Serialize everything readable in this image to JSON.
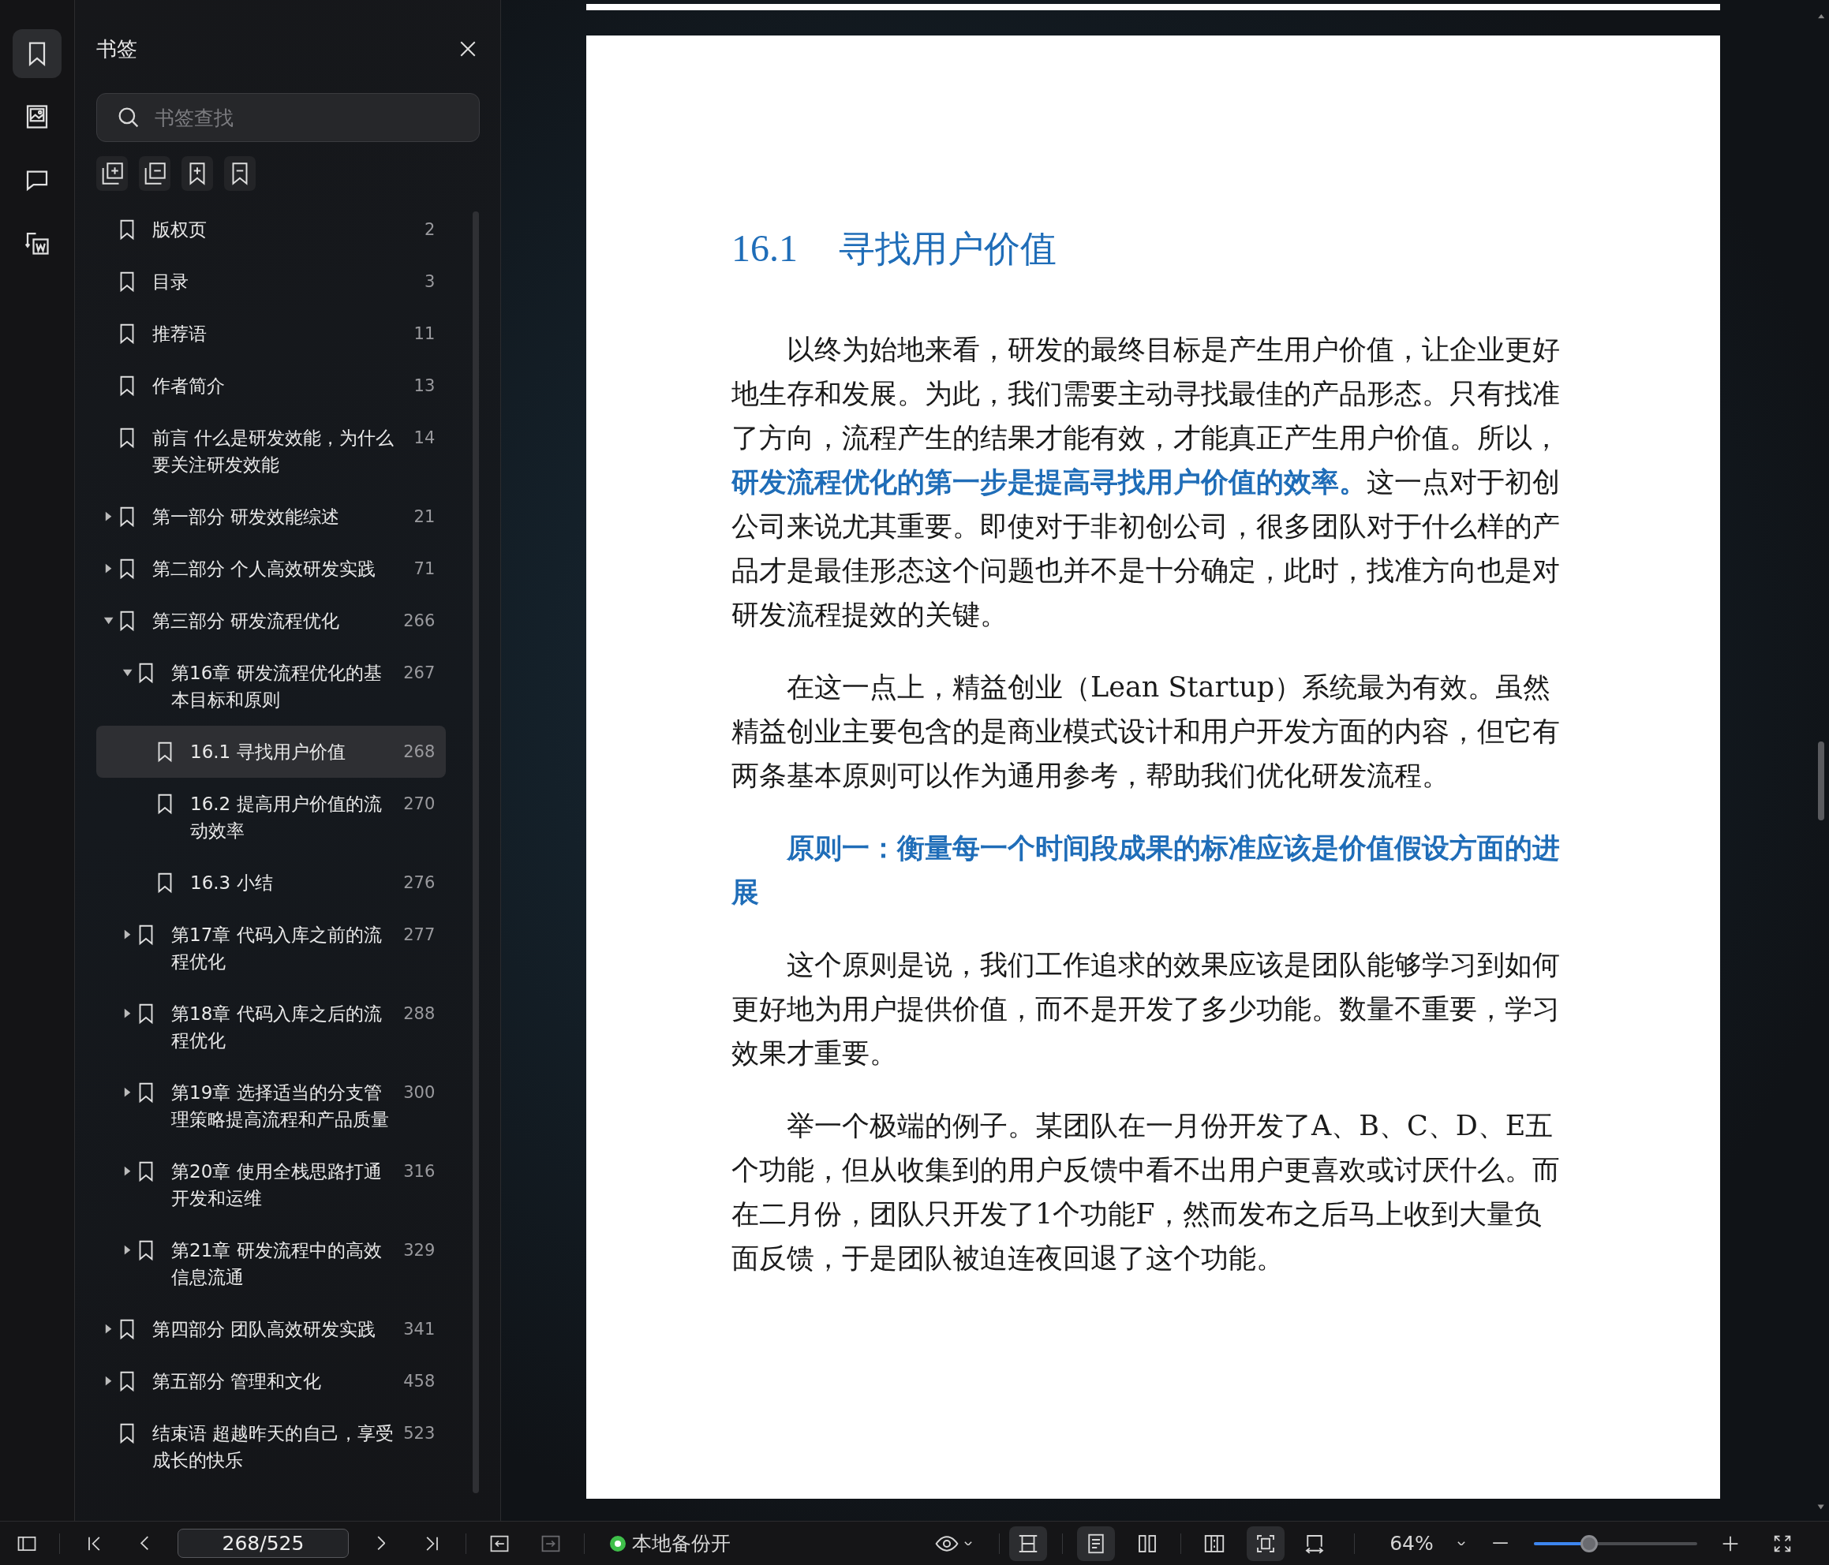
{
  "rail": [
    {
      "kind": "bookmarks",
      "selected": true
    },
    {
      "kind": "images",
      "selected": false
    },
    {
      "kind": "comments",
      "selected": false
    },
    {
      "kind": "convert",
      "selected": false
    }
  ],
  "sidebar": {
    "title": "书签",
    "search": {
      "placeholder": "书签查找"
    },
    "bookmarks": [
      {
        "title": "版权页",
        "page": "2",
        "kind": "leaf",
        "selected": false
      },
      {
        "title": "目录",
        "page": "3",
        "kind": "leaf",
        "selected": false
      },
      {
        "title": "推荐语",
        "page": "11",
        "kind": "leaf",
        "selected": false
      },
      {
        "title": "作者简介",
        "page": "13",
        "kind": "leaf",
        "selected": false
      },
      {
        "title": "前言 什么是研发效能，为什么要关注研发效能",
        "page": "14",
        "kind": "leaf",
        "selected": false
      },
      {
        "title": "第一部分 研发效能综述",
        "page": "21",
        "kind": "branch",
        "expanded": false,
        "selected": false
      },
      {
        "title": "第二部分 个人高效研发实践",
        "page": "71",
        "kind": "branch",
        "expanded": false,
        "selected": false
      },
      {
        "title": "第三部分 研发流程优化",
        "page": "266",
        "kind": "branch",
        "expanded": true,
        "selected": false,
        "children": [
          {
            "title": "第16章 研发流程优化的基本目标和原则",
            "page": "267",
            "kind": "branch",
            "expanded": true,
            "selected": false,
            "children": [
              {
                "title": "16.1 寻找用户价值",
                "page": "268",
                "kind": "leaf",
                "selected": true
              },
              {
                "title": "16.2 提高用户价值的流动效率",
                "page": "270",
                "kind": "leaf",
                "selected": false
              },
              {
                "title": "16.3 小结",
                "page": "276",
                "kind": "leaf",
                "selected": false
              }
            ]
          },
          {
            "title": "第17章 代码入库之前的流程优化",
            "page": "277",
            "kind": "branch",
            "expanded": false,
            "selected": false
          },
          {
            "title": "第18章 代码入库之后的流程优化",
            "page": "288",
            "kind": "branch",
            "expanded": false,
            "selected": false
          },
          {
            "title": "第19章 选择适当的分支管理策略提高流程和产品质量",
            "page": "300",
            "kind": "branch",
            "expanded": false,
            "selected": false
          },
          {
            "title": "第20章 使用全栈思路打通开发和运维",
            "page": "316",
            "kind": "branch",
            "expanded": false,
            "selected": false
          },
          {
            "title": "第21章 研发流程中的高效信息流通",
            "page": "329",
            "kind": "branch",
            "expanded": false,
            "selected": false
          }
        ]
      },
      {
        "title": "第四部分 团队高效研发实践",
        "page": "341",
        "kind": "branch",
        "expanded": false,
        "selected": false
      },
      {
        "title": "第五部分 管理和文化",
        "page": "458",
        "kind": "branch",
        "expanded": false,
        "selected": false
      },
      {
        "title": "结束语 超越昨天的自己，享受成长的快乐",
        "page": "523",
        "kind": "leaf",
        "selected": false
      }
    ]
  },
  "document": {
    "heading": {
      "number": "16.1",
      "title": "寻找用户价值"
    },
    "paragraphs": [
      {
        "kind": "body",
        "text": "以终为始地来看，研发的最终目标是产生用户价值，让企业更好地生存和发展。为此，我们需要主动寻找最佳的产品形态。只有找准了方向，流程产生的结果才能有效，才能真正产生用户价值。所以，**研发流程优化的第一步是提高寻找用户价值的效率。**这一点对于初创公司来说尤其重要。即使对于非初创公司，很多团队对于什么样的产品才是最佳形态这个问题也并不是十分确定，此时，找准方向也是对研发流程提效的关键。"
      },
      {
        "kind": "body",
        "text": "在这一点上，精益创业（Lean Startup）系统最为有效。虽然精益创业主要包含的是商业模式设计和用户开发方面的内容，但它有两条基本原则可以作为通用参考，帮助我们优化研发流程。"
      },
      {
        "kind": "principle",
        "text": "原则一：衡量每一个时间段成果的标准应该是价值假设方面的进展"
      },
      {
        "kind": "body",
        "text": "这个原则是说，我们工作追求的效果应该是团队能够学习到如何更好地为用户提供价值，而不是开发了多少功能。数量不重要，学习效果才重要。"
      },
      {
        "kind": "body",
        "text": "举一个极端的例子。某团队在一月份开发了A、B、C、D、E五个功能，但从收集到的用户反馈中看不出用户更喜欢或讨厌什么。而在二月份，团队只开发了1个功能F，然而发布之后马上收到大量负面反馈，于是团队被迫连夜回退了这个功能。"
      }
    ]
  },
  "status_bar": {
    "page_field": {
      "value": "268/525"
    },
    "history": [
      {
        "kind": "back",
        "disabled": false
      },
      {
        "kind": "forward",
        "disabled": true
      }
    ],
    "backup": {
      "label": "本地备份开",
      "on": true
    },
    "view_modes": [
      {
        "kind": "scroll",
        "selected": true
      },
      {
        "kind": "single",
        "selected": true
      },
      {
        "kind": "double",
        "selected": false
      },
      {
        "kind": "split",
        "selected": false
      },
      {
        "kind": "fit",
        "selected": true
      },
      {
        "kind": "width",
        "selected": false
      }
    ],
    "zoom": {
      "value": "64%",
      "level": 0.34
    }
  }
}
